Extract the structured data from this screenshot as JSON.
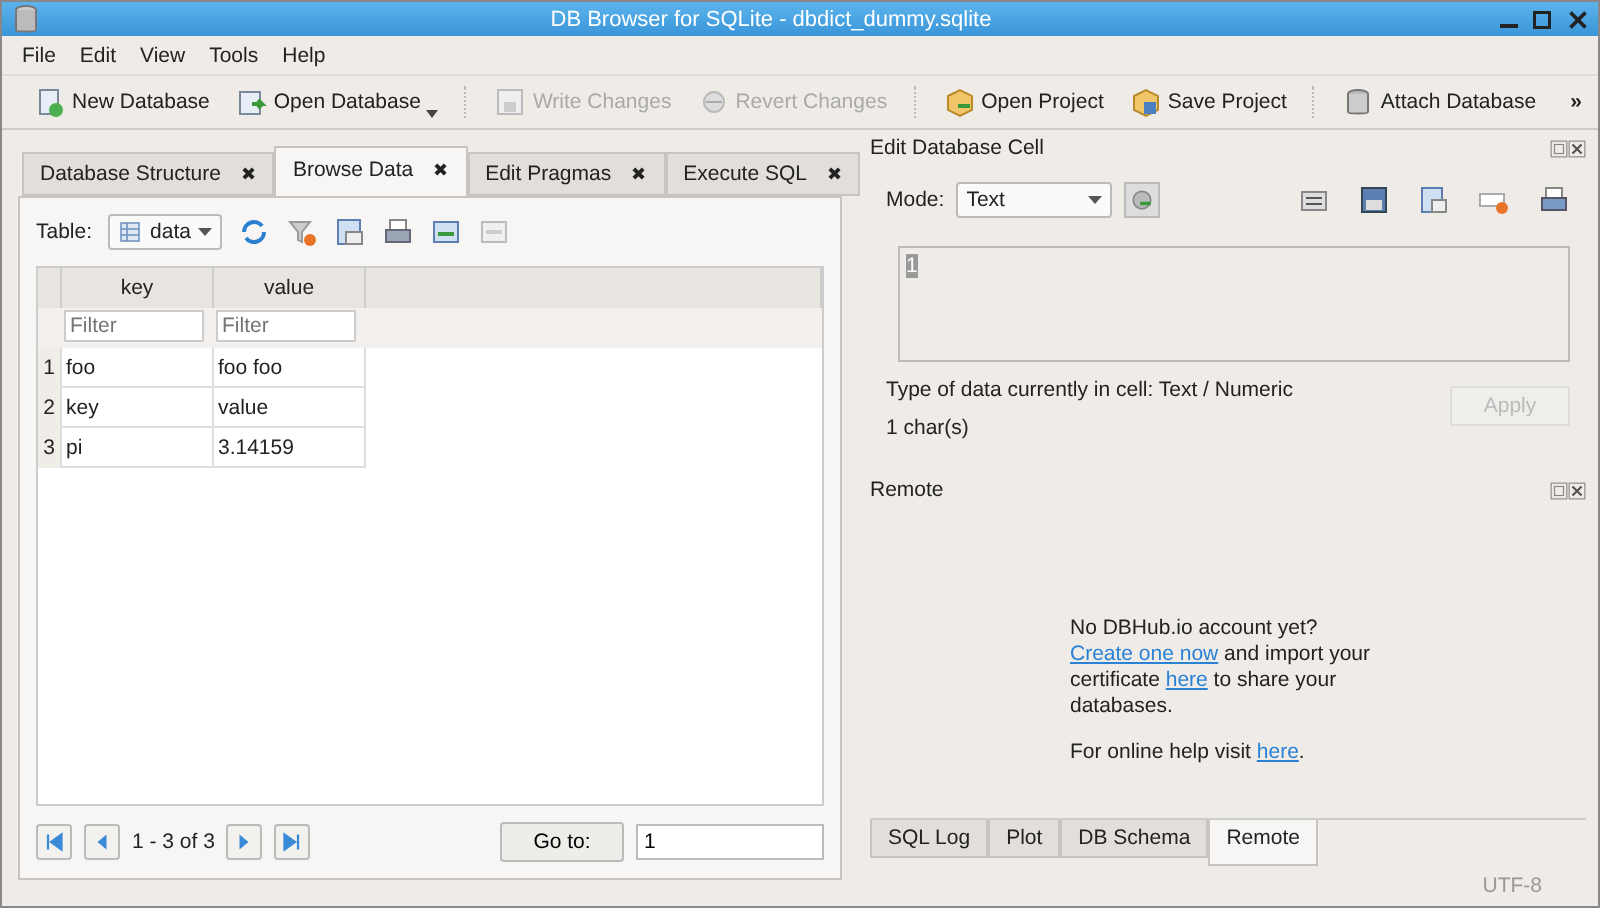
{
  "window": {
    "title": "DB Browser for SQLite - dbdict_dummy.sqlite"
  },
  "menu": [
    "File",
    "Edit",
    "View",
    "Tools",
    "Help"
  ],
  "toolbar": [
    {
      "label": "New Database",
      "disabled": false,
      "dropdown": false
    },
    {
      "label": "Open Database",
      "disabled": false,
      "dropdown": true
    },
    {
      "label": "Write Changes",
      "disabled": true,
      "dropdown": false
    },
    {
      "label": "Revert Changes",
      "disabled": true,
      "dropdown": false
    },
    {
      "label": "Open Project",
      "disabled": false,
      "dropdown": false
    },
    {
      "label": "Save Project",
      "disabled": false,
      "dropdown": false
    },
    {
      "label": "Attach Database",
      "disabled": false,
      "dropdown": false
    }
  ],
  "toolbar_more": "»",
  "tabs": [
    {
      "label": "Database Structure",
      "selected": false
    },
    {
      "label": "Browse Data",
      "selected": true
    },
    {
      "label": "Edit Pragmas",
      "selected": false
    },
    {
      "label": "Execute SQL",
      "selected": false
    }
  ],
  "tab_close": "✖",
  "browse": {
    "table_label": "Table:",
    "table_value": "data",
    "columns": [
      {
        "name": "key",
        "filter_placeholder": "Filter"
      },
      {
        "name": "value",
        "filter_placeholder": "Filter"
      }
    ],
    "rows": [
      {
        "number": "1",
        "cells": [
          "foo",
          "foo foo"
        ]
      },
      {
        "number": "2",
        "cells": [
          "key",
          "value"
        ]
      },
      {
        "number": "3",
        "cells": [
          "pi",
          "3.14159"
        ]
      }
    ],
    "range": "1 - 3 of 3",
    "goto_button": "Go to:",
    "goto_value": "1"
  },
  "edit_cell": {
    "title": "Edit Database Cell",
    "mode_label": "Mode:",
    "mode_value": "Text",
    "value": "1",
    "type_text": "Type of data currently in cell: Text / Numeric",
    "size_text": "1 char(s)",
    "apply": {
      "label": "Apply",
      "disabled": true
    }
  },
  "remote": {
    "title": "Remote",
    "paragraphs": [
      [
        {
          "kind": "text",
          "text": "No DBHub.io account yet? "
        },
        {
          "kind": "link",
          "text": "Create one now"
        },
        {
          "kind": "text",
          "text": " and import your certificate "
        },
        {
          "kind": "link",
          "text": "here"
        },
        {
          "kind": "text",
          "text": " to share your databases."
        }
      ],
      [
        {
          "kind": "text",
          "text": "For online help visit "
        },
        {
          "kind": "link",
          "text": "here"
        },
        {
          "kind": "text",
          "text": "."
        }
      ]
    ]
  },
  "bottom_tabs": [
    {
      "label": "SQL Log",
      "selected": false
    },
    {
      "label": "Plot",
      "selected": false
    },
    {
      "label": "DB Schema",
      "selected": false
    },
    {
      "label": "Remote",
      "selected": true
    }
  ],
  "status_bar": {
    "encoding": "UTF-8"
  }
}
